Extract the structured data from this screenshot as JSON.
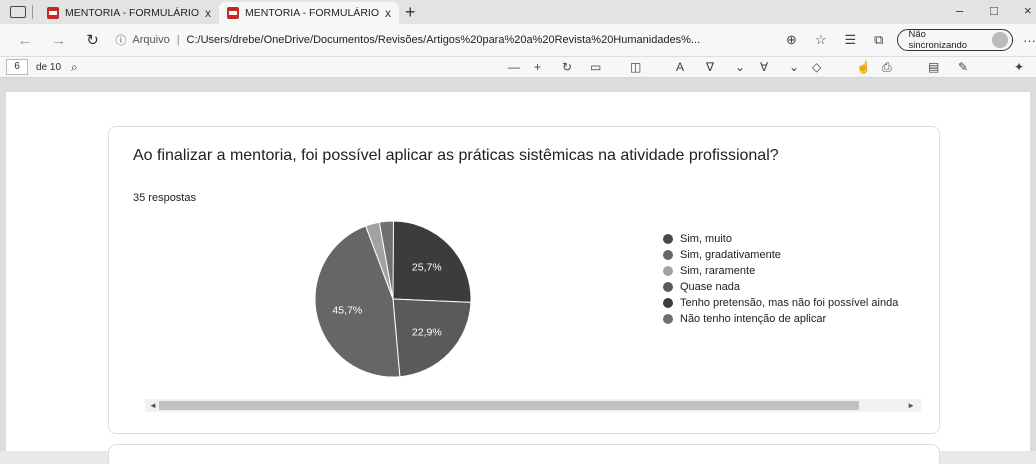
{
  "tabs": [
    {
      "title": "MENTORIA - FORMULÁRIO ENVI",
      "close": "x"
    },
    {
      "title": "MENTORIA - FORMULÁRIO ENVI",
      "close": "x"
    }
  ],
  "window": {
    "new_tab": "+",
    "minimize": "–",
    "maximize": "□",
    "close": "×"
  },
  "address": {
    "info_icon": "ⓘ",
    "protocol": "Arquivo",
    "separator": "|",
    "url": "C:/Users/drebe/OneDrive/Documentos/Revisões/Artigos%20para%20a%20Revista%20Humanidades%...",
    "sync_label": "Não sincronizando",
    "more": "···"
  },
  "nav": {
    "back": "←",
    "forward": "→",
    "refresh": "↻"
  },
  "pdf_toolbar": {
    "page": "6",
    "of_pages": "de 10",
    "search": "⌕"
  },
  "question": {
    "title": "Ao finalizar a mentoria, foi possível aplicar as práticas sistêmicas na atividade profissional?",
    "responses": "35 respostas"
  },
  "chart_data": {
    "type": "pie",
    "total_responses": 35,
    "slices": [
      {
        "label": "Tenho pretensão, mas não foi possível ainda",
        "percent": 25.7,
        "shown": "25,7%",
        "color": "#3c3c3c"
      },
      {
        "label": "Quase nada",
        "percent": 22.9,
        "shown": "22,9%",
        "color": "#5a5a5a"
      },
      {
        "label": "Sim, gradativamente",
        "percent": 45.7,
        "shown": "45,7%",
        "color": "#666666"
      },
      {
        "label": "Sim, raramente",
        "percent": 2.9,
        "shown": "",
        "color": "#a2a2a2"
      },
      {
        "label": "Não tenho intenção de aplicar",
        "percent": 2.9,
        "shown": "",
        "color": "#707070"
      }
    ],
    "legend": [
      {
        "label": "Sim, muito",
        "color": "#4a4a4a"
      },
      {
        "label": "Sim, gradativamente",
        "color": "#666666"
      },
      {
        "label": "Sim, raramente",
        "color": "#a2a2a2"
      },
      {
        "label": "Quase nada",
        "color": "#5a5a5a"
      },
      {
        "label": "Tenho pretensão, mas não foi possível ainda",
        "color": "#3c3c3c"
      },
      {
        "label": "Não tenho intenção de aplicar",
        "color": "#707070"
      }
    ],
    "legend_position": "right"
  },
  "scrollbar": {
    "left": "◄",
    "right": "►"
  }
}
